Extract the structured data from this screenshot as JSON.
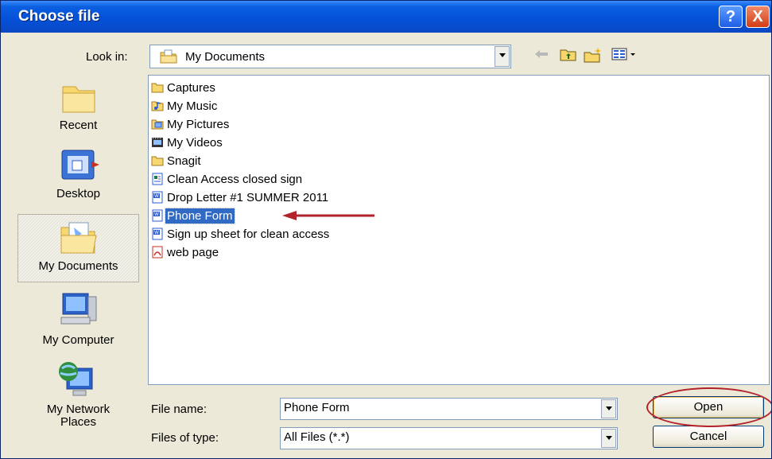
{
  "window": {
    "title": "Choose file",
    "help_button": "?",
    "close_button": "X"
  },
  "toolbar": {
    "look_in_label": "Look in:",
    "look_in_value": "My Documents",
    "back_icon": "back-arrow-icon",
    "up_icon": "up-one-level-icon",
    "new_folder_icon": "new-folder-icon",
    "views_icon": "views-menu-icon"
  },
  "places": [
    {
      "label": "Recent",
      "icon": "recent-folder-icon"
    },
    {
      "label": "Desktop",
      "icon": "desktop-icon"
    },
    {
      "label": "My Documents",
      "icon": "my-documents-icon",
      "selected": true
    },
    {
      "label": "My Computer",
      "icon": "my-computer-icon"
    },
    {
      "label": "My Network\nPlaces",
      "icon": "network-places-icon"
    }
  ],
  "files": [
    {
      "name": "Captures",
      "type": "folder"
    },
    {
      "name": "My Music",
      "type": "music-folder"
    },
    {
      "name": "My Pictures",
      "type": "pictures-folder"
    },
    {
      "name": "My Videos",
      "type": "videos-folder"
    },
    {
      "name": "Snagit",
      "type": "folder"
    },
    {
      "name": "Clean Access closed sign",
      "type": "publisher"
    },
    {
      "name": "Drop Letter #1 SUMMER 2011",
      "type": "word"
    },
    {
      "name": "Phone Form",
      "type": "word",
      "selected": true
    },
    {
      "name": "Sign up sheet for clean access",
      "type": "word"
    },
    {
      "name": "web page",
      "type": "pdf"
    }
  ],
  "form": {
    "file_name_label": "File name:",
    "file_name_value": "Phone Form",
    "file_type_label": "Files of type:",
    "file_type_value": "All Files (*.*)",
    "open_label": "Open",
    "cancel_label": "Cancel"
  },
  "colors": {
    "titlebar": "#0450d8",
    "selection": "#316ac5",
    "annotation_red": "#b2222a"
  }
}
